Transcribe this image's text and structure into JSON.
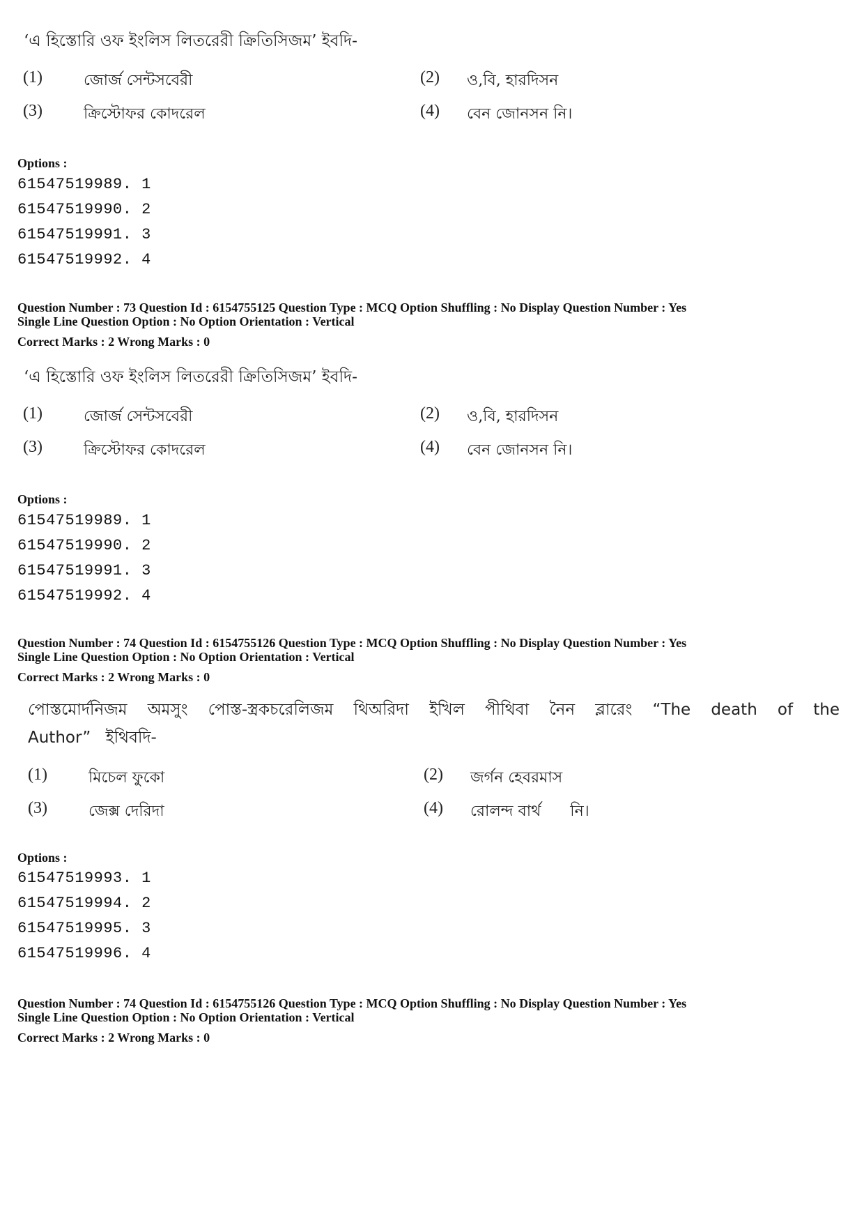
{
  "blocks": [
    {
      "question_text": "‘এ হিস্তোরি ওফ ইংলিস লিতরেরী ক্রিতিসিজম’ ইবদি-",
      "choices": [
        {
          "num": "(1)",
          "text": "জোর্জ সেন্টসবেরী"
        },
        {
          "num": "(2)",
          "text": "ও,বি, হারদিসন"
        },
        {
          "num": "(3)",
          "text": "ক্রিস্টোফর কোদরেল"
        },
        {
          "num": "(4)",
          "text": "বেন জোনসন নি।"
        }
      ],
      "options_label": "Options :",
      "options": [
        "61547519989. 1",
        "61547519990. 2",
        "61547519991. 3",
        "61547519992. 4"
      ]
    },
    {
      "meta_line1": "Question Number : 73  Question Id : 6154755125  Question Type : MCQ  Option Shuffling : No  Display Question Number : Yes",
      "meta_line2": "Single Line Question Option : No  Option Orientation : Vertical",
      "marks_line": "Correct Marks : 2  Wrong Marks : 0",
      "question_text": "‘এ হিস্তোরি ওফ ইংলিস লিতরেরী ক্রিতিসিজম’ ইবদি-",
      "choices": [
        {
          "num": "(1)",
          "text": "জোর্জ সেন্টসবেরী"
        },
        {
          "num": "(2)",
          "text": "ও,বি, হারদিসন"
        },
        {
          "num": "(3)",
          "text": "ক্রিস্টোফর কোদরেল"
        },
        {
          "num": "(4)",
          "text": "বেন জোনসন নি।"
        }
      ],
      "options_label": "Options :",
      "options": [
        "61547519989. 1",
        "61547519990. 2",
        "61547519991. 3",
        "61547519992. 4"
      ]
    },
    {
      "meta_line1": "Question Number : 74  Question Id : 6154755126  Question Type : MCQ  Option Shuffling : No  Display Question Number : Yes",
      "meta_line2": "Single Line Question Option : No  Option Orientation : Vertical",
      "marks_line": "Correct Marks : 2  Wrong Marks : 0",
      "question_text": "পোস্তমোর্দনিজম অমসুং পোস্ত-স্ত্রকচরেলিজম থিঅরিদা ইখিল পীথিবা নৈন ব্লারেং “The death of the Author” ইথিবদি-",
      "choices": [
        {
          "num": "(1)",
          "text": "মিচেল ফুকো"
        },
        {
          "num": "(2)",
          "text": "জর্গন হেবরমাস"
        },
        {
          "num": "(3)",
          "text": "জেক্স দেরিদা"
        },
        {
          "num": "(4)",
          "text": "রোলন্দ বার্থ      নি।"
        }
      ],
      "options_label": "Options :",
      "options": [
        "61547519993. 1",
        "61547519994. 2",
        "61547519995. 3",
        "61547519996. 4"
      ]
    },
    {
      "meta_line1": "Question Number : 74  Question Id : 6154755126  Question Type : MCQ  Option Shuffling : No  Display Question Number : Yes",
      "meta_line2": "Single Line Question Option : No  Option Orientation : Vertical",
      "marks_line": "Correct Marks : 2  Wrong Marks : 0"
    }
  ]
}
